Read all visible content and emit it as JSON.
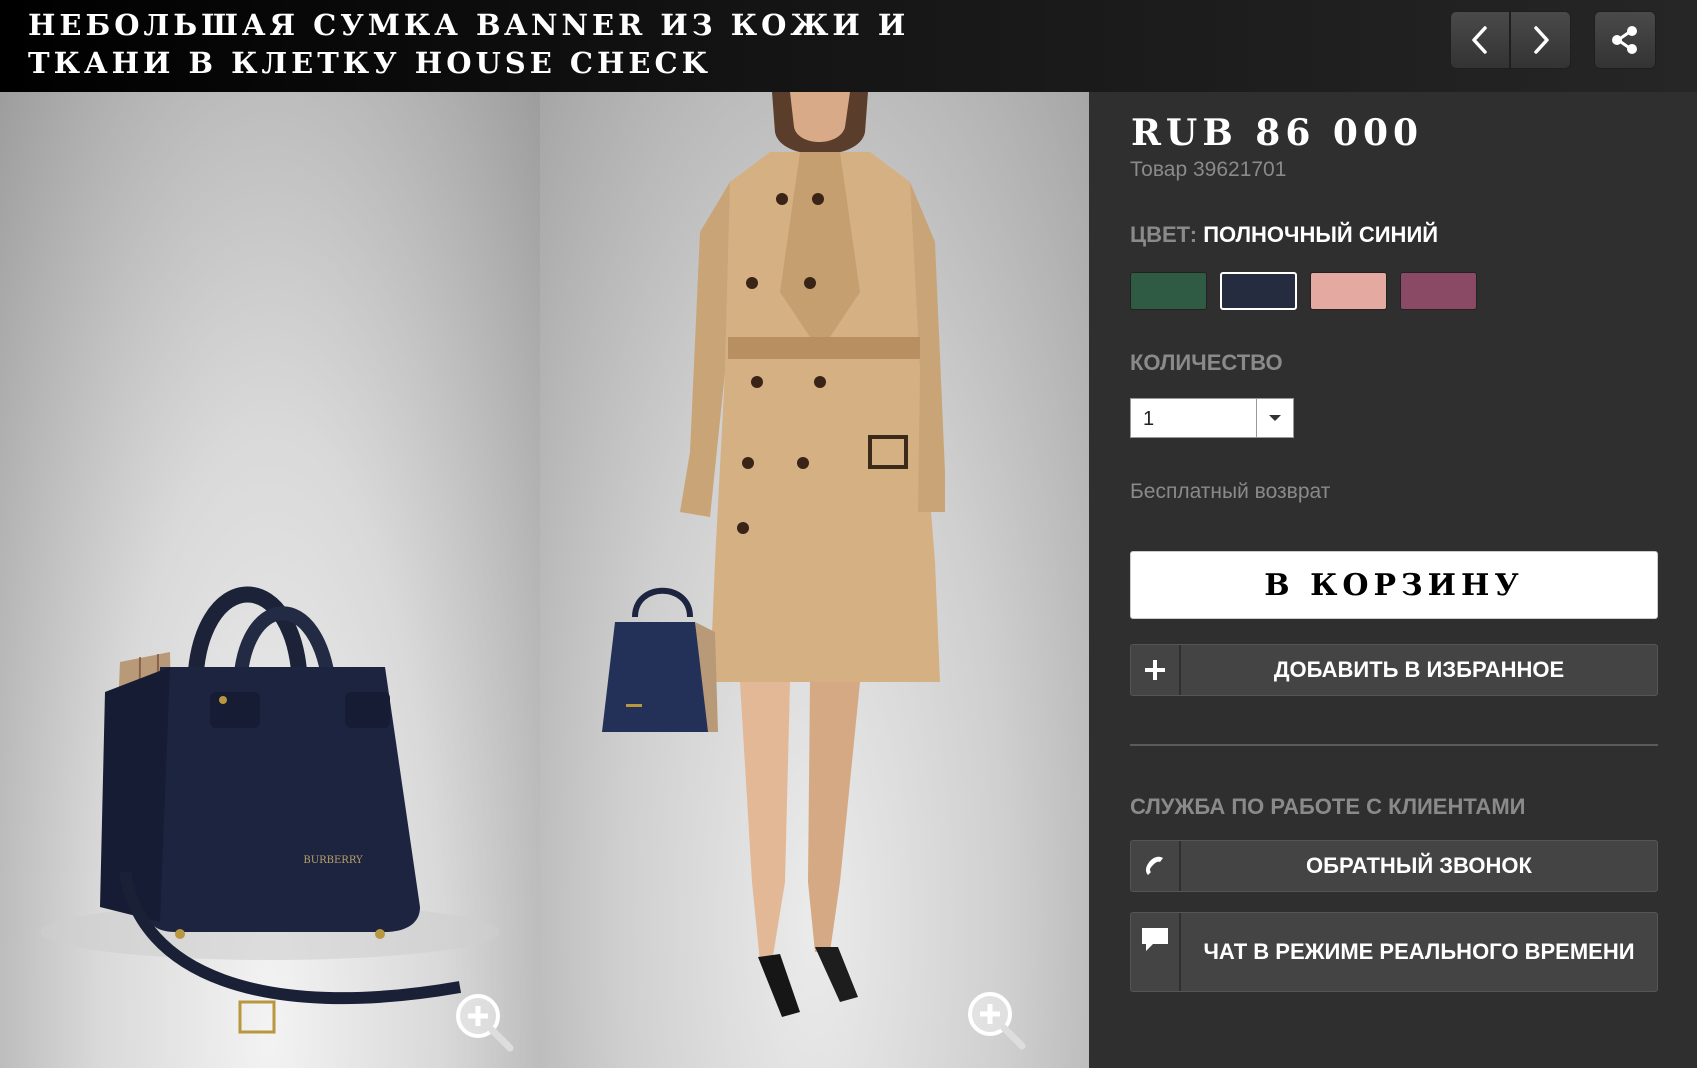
{
  "header": {
    "title": "Небольшая сумка Banner из кожи и ткани в клетку House Check",
    "prev_icon": "chevron-left-icon",
    "next_icon": "chevron-right-icon",
    "share_icon": "share-icon"
  },
  "gallery": {
    "zoom_icon": "zoom-in-icon",
    "bag_brand_mark": "BURBERRY"
  },
  "product": {
    "price": "RUB 86 000",
    "sku": "Товар 39621701",
    "color_label": "ЦВЕТ:",
    "color_value": "ПОЛНОЧНЫЙ СИНИЙ",
    "swatches": [
      {
        "name": "green",
        "color": "#2f5a43",
        "selected": false
      },
      {
        "name": "midnight-blue",
        "color": "#262c40",
        "selected": true
      },
      {
        "name": "pink",
        "color": "#e4a9a0",
        "selected": false
      },
      {
        "name": "plum",
        "color": "#8a4a65",
        "selected": false
      }
    ],
    "quantity_label": "КОЛИЧЕСТВО",
    "quantity_value": "1",
    "returns_text": "Бесплатный возврат",
    "add_to_cart": "В КОРЗИНУ",
    "add_favorite": "ДОБАВИТЬ В ИЗБРАННОЕ"
  },
  "service": {
    "label": "СЛУЖБА ПО РАБОТЕ С КЛИЕНТАМИ",
    "callback": "ОБРАТНЫЙ ЗВОНОК",
    "chat": "ЧАТ В РЕЖИМЕ РЕАЛЬНОГО ВРЕМЕНИ"
  },
  "colors": {
    "panel_bg": "#2f2f2f",
    "button_gray": "#444444",
    "muted_text": "#8a8a8a"
  }
}
